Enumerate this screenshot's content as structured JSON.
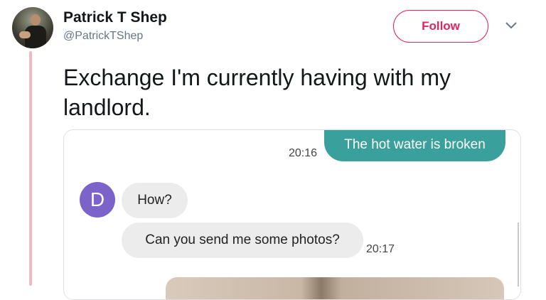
{
  "tweet": {
    "author_name": "Patrick T Shep",
    "handle": "@PatrickTShep",
    "follow_label": "Follow",
    "text": "Exchange I'm currently having with my landlord."
  },
  "chat": {
    "messages": [
      {
        "direction": "outgoing",
        "text": "The hot water is broken",
        "time": "20:16"
      },
      {
        "direction": "incoming",
        "text": "How?"
      },
      {
        "direction": "incoming",
        "text": "Can you send me some photos?",
        "time": "20:17"
      }
    ],
    "contact_initial": "D"
  },
  "colors": {
    "follow_accent": "#e0245e",
    "outgoing_bubble": "#3aa09c",
    "incoming_bubble": "#ececec",
    "contact_avatar": "#7c63c9",
    "thread_line": "#f0b8c2"
  },
  "icons": [
    "profile-avatar",
    "chevron-down-icon"
  ]
}
